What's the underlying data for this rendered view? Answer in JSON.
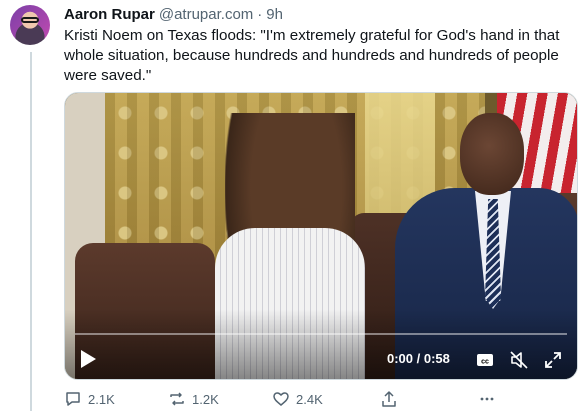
{
  "tweet": {
    "author_name": "Aaron Rupar",
    "author_handle": "@atrupar.com",
    "separator": "·",
    "timestamp": "9h",
    "text": "Kristi Noem on Texas floods: \"I'm extremely grateful for God's hand in that whole situation, because hundreds and hundreds and hundreds of people were saved.\""
  },
  "video": {
    "timecode": "0:00 / 0:58",
    "progress": 0,
    "controls": {
      "play_icon": "play-icon",
      "captions_icon": "cc-icon",
      "mute_icon": "mute-icon",
      "fullscreen_icon": "fullscreen-icon"
    }
  },
  "actions": {
    "replies": "2.1K",
    "reposts": "1.2K",
    "likes": "2.4K",
    "share_icon": "share-icon",
    "more_icon": "more-icon"
  }
}
